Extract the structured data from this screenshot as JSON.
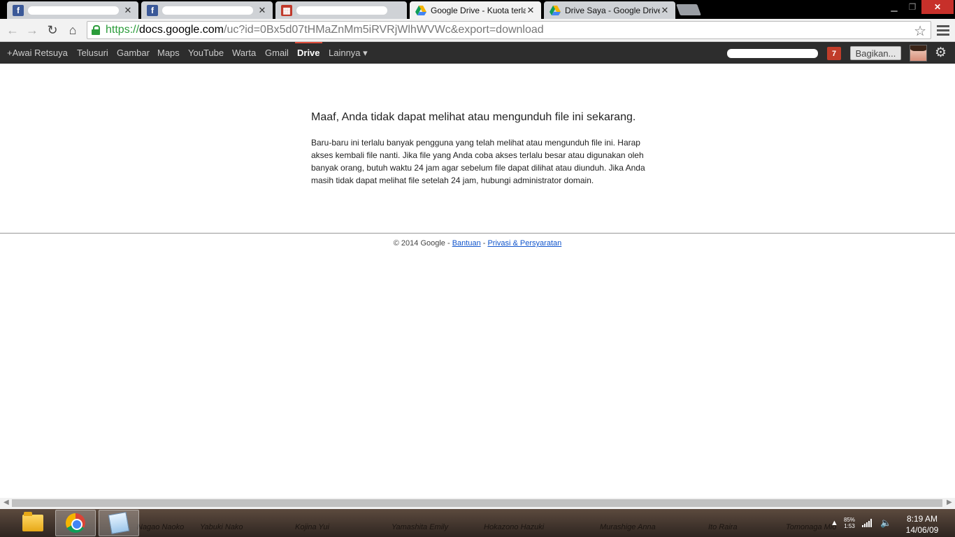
{
  "browser": {
    "tabs": [
      {
        "favicon": "facebook-icon",
        "title": "",
        "redacted": true
      },
      {
        "favicon": "facebook-icon",
        "title": "",
        "redacted": true
      },
      {
        "favicon": "film-clapper-icon",
        "title": "",
        "redacted": true
      },
      {
        "favicon": "google-drive-icon",
        "title": "Google Drive - Kuota terla",
        "active": true
      },
      {
        "favicon": "google-drive-icon",
        "title": "Drive Saya - Google Drive"
      }
    ],
    "url": {
      "scheme": "https://",
      "host": "docs.google.com",
      "rest": "/uc?id=0Bx5d07tHMaZnMm5iRVRjWlhWVWc&export=download"
    }
  },
  "gbar": {
    "items": [
      "+Awai Retsuya",
      "Telusuri",
      "Gambar",
      "Maps",
      "YouTube",
      "Warta",
      "Gmail",
      "Drive",
      "Lainnya ▾"
    ],
    "active": "Drive",
    "notifications": "7",
    "share_label": "Bagikan..."
  },
  "main": {
    "heading": "Maaf, Anda tidak dapat melihat atau mengunduh file ini sekarang.",
    "body": "Baru-baru ini terlalu banyak pengguna yang telah melihat atau mengunduh file ini. Harap akses kembali file nanti. Jika file yang Anda coba akses terlalu besar atau digunakan oleh banyak orang, butuh waktu 24 jam agar sebelum file dapat dilihat atau diunduh. Jika Anda masih tidak dapat melihat file setelah 24 jam, hubungi administrator domain."
  },
  "footer": {
    "copyright": "© 2014 Google",
    "sep": " - ",
    "help": "Bantuan",
    "privacy": "Privasi & Persyaratan"
  },
  "taskbar": {
    "wallpaper_names": [
      "Nagao Naoko",
      "Yabuki Nako",
      "Kojina Yui",
      "Yamashita Emily",
      "Hokazono Hazuki",
      "Murashige Anna",
      "Ito Raira",
      "Tomonaga Mio"
    ],
    "battery": "85%",
    "battery_time": "1:53",
    "time": "8:19 AM",
    "date": "14/06/09"
  }
}
